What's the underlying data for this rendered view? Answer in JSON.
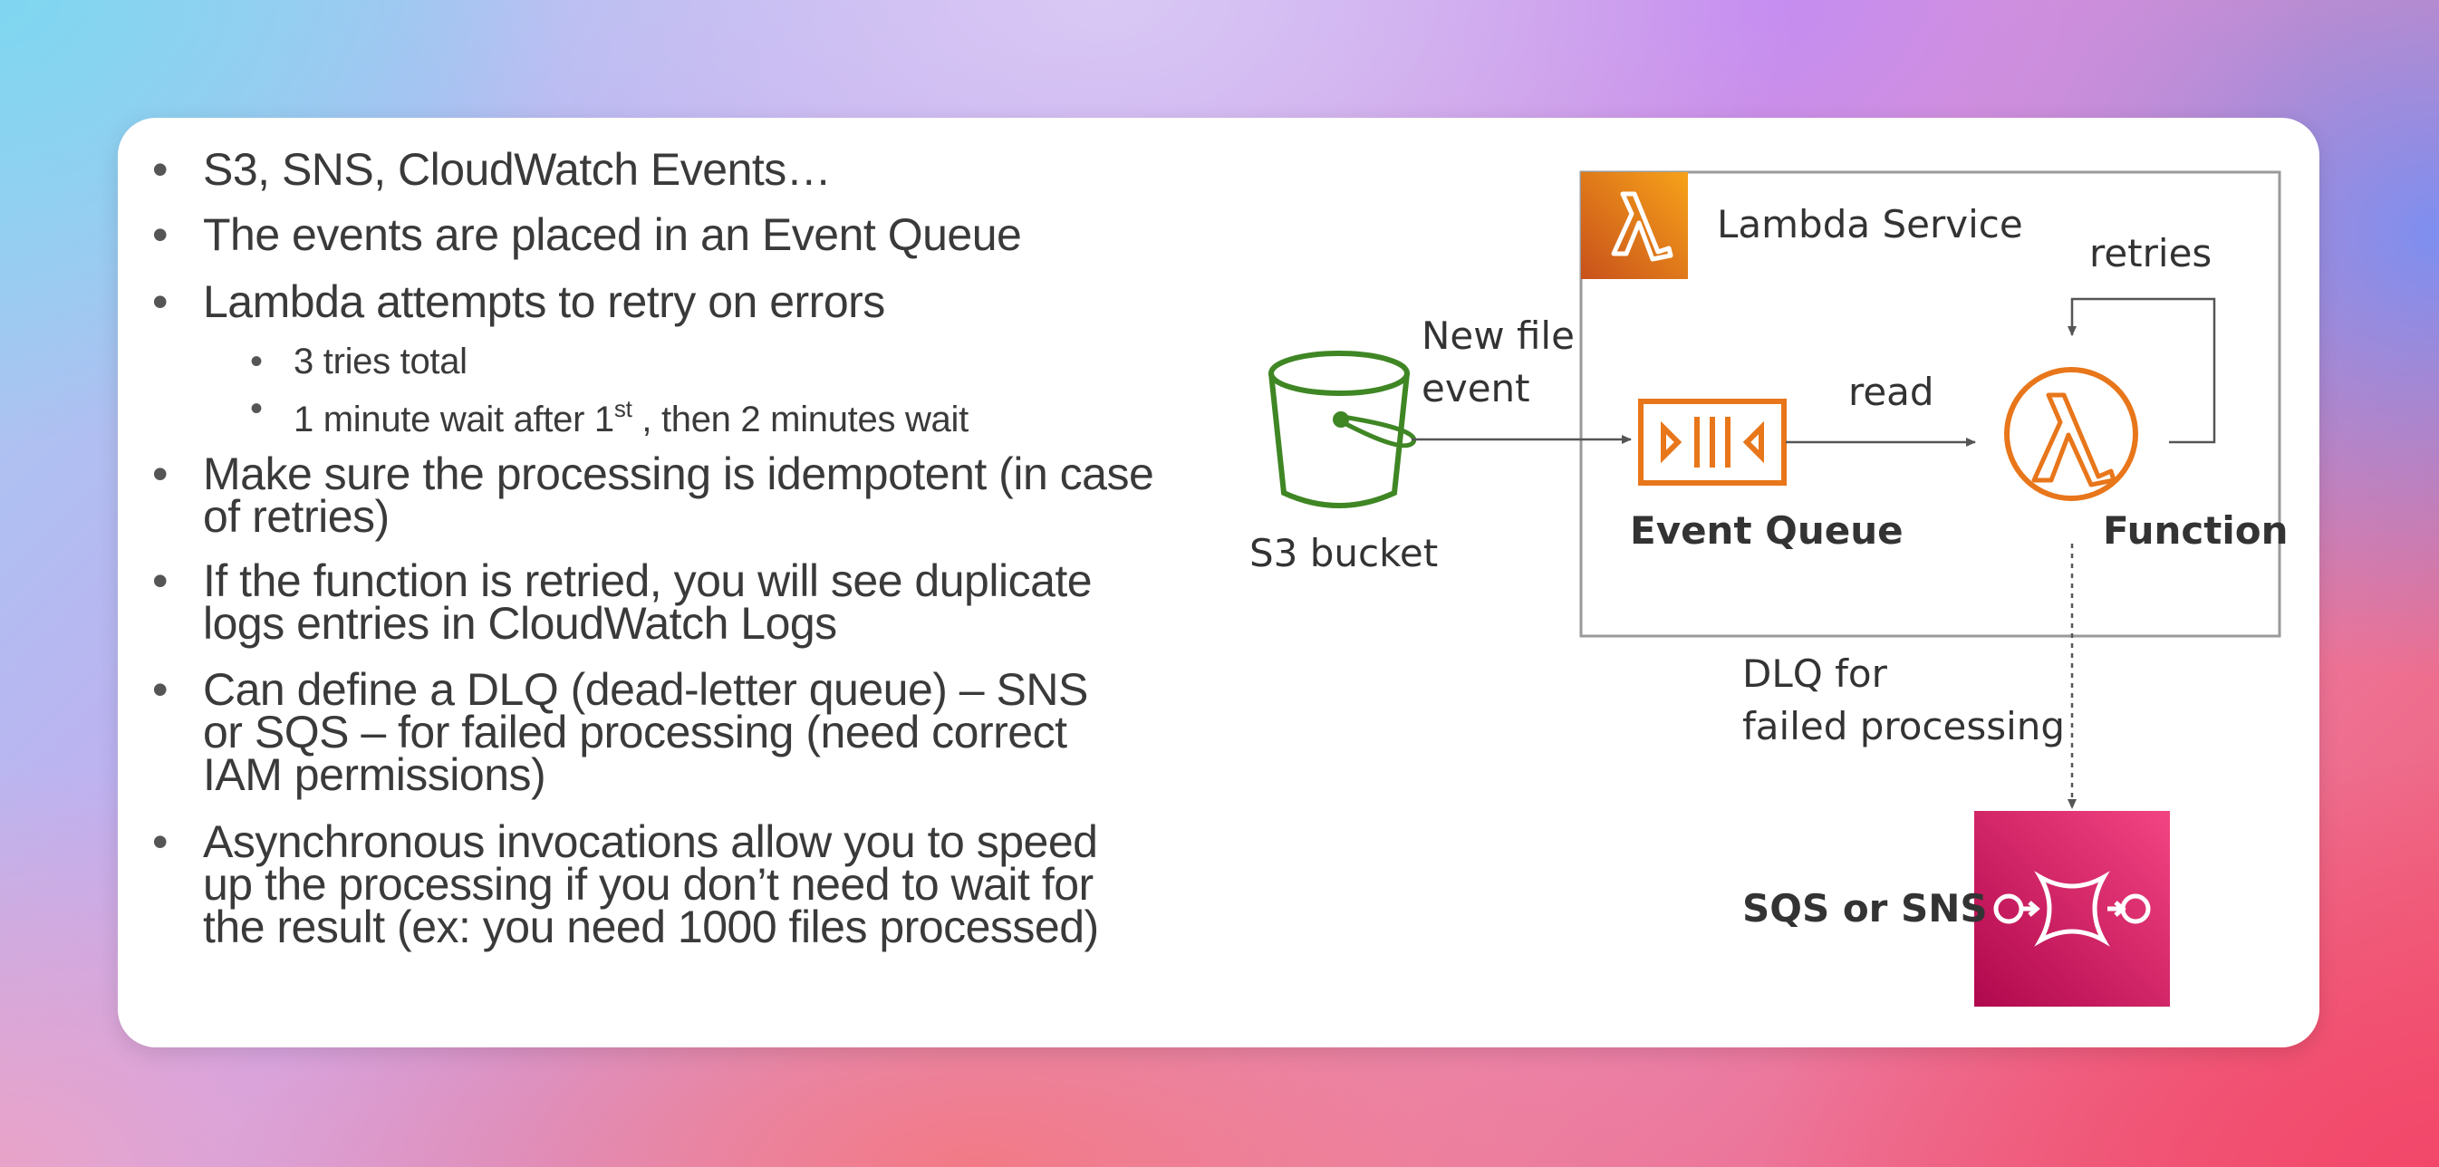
{
  "bullets": [
    {
      "text": "S3, SNS, CloudWatch Events…"
    },
    {
      "text": "The events are placed in an Event Queue"
    },
    {
      "text": "Lambda attempts to retry on errors"
    },
    {
      "text": "3 tries total"
    },
    {
      "text_before": "1 minute wait after 1",
      "sup": "st",
      "text_after": " , then 2 minutes wait"
    },
    {
      "line1": "Make sure the processing is idempotent (in case",
      "line2": "of retries)"
    },
    {
      "line1": "If the function is retried, you will see duplicate",
      "line2": "logs entries in CloudWatch Logs"
    },
    {
      "line1": "Can define a DLQ (dead-letter queue) – SNS",
      "line2": "or SQS – for failed processing (need correct",
      "line3": "IAM permissions)"
    },
    {
      "line1": "Asynchronous invocations allow you to speed",
      "line2": "up the processing if you don’t need to wait for",
      "line3": "the result (ex: you need 1000 files processed)"
    }
  ],
  "diagram": {
    "lambda_service_label": "Lambda Service",
    "retries_label": "retries",
    "new_file_line1": "New file",
    "new_file_line2": "event",
    "read_label": "read",
    "s3_label": "S3 bucket",
    "event_queue_label": "Event Queue",
    "function_label": "Function",
    "dlq_line1": "DLQ for",
    "dlq_line2": "failed processing",
    "sqs_sns_label": "SQS or SNS",
    "colors": {
      "lambda_orange": "#e8761a",
      "s3_green": "#3f8624",
      "sqs_pink": "#d2245c",
      "arrow": "#555555"
    },
    "icons": [
      "lambda-icon",
      "s3-bucket-icon",
      "event-queue-icon",
      "lambda-function-icon",
      "sqs-sns-icon"
    ]
  }
}
